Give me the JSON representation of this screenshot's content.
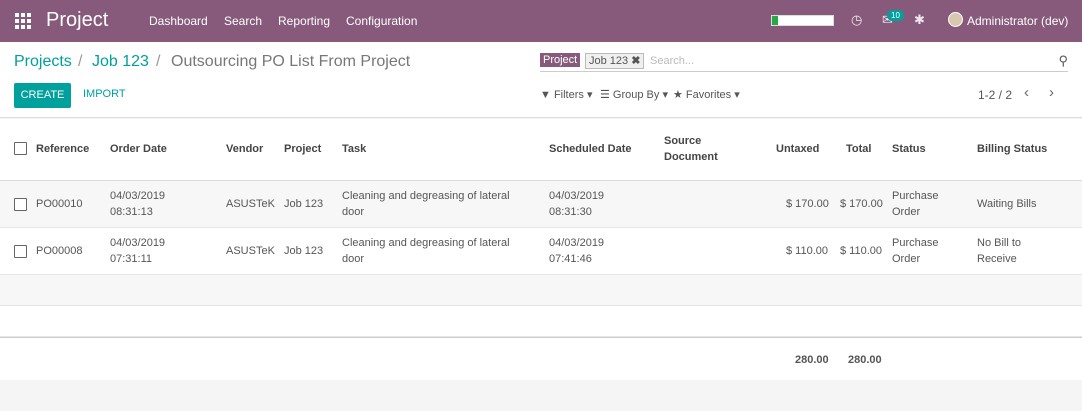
{
  "navbar": {
    "app_name": "Project",
    "menus": [
      "Dashboard",
      "Search",
      "Reporting",
      "Configuration"
    ],
    "progress_fraction": 0.1,
    "chat_badge": "10",
    "user": "Administrator (dev)",
    "accent": "#875a7b"
  },
  "breadcrumb": {
    "projects": "Projects",
    "job": "Job 123",
    "current": "Outsourcing PO List From Project",
    "sep": "/"
  },
  "actions": {
    "create": "CREATE",
    "import": "IMPORT"
  },
  "search": {
    "facet_label": "Project",
    "facet_value": "Job 123",
    "placeholder": "Search...",
    "filters": "Filters",
    "group_by": "Group By",
    "favorites": "Favorites"
  },
  "pager": {
    "text": "1-2 / 2"
  },
  "table": {
    "headers": {
      "reference": "Reference",
      "order_date": "Order Date",
      "vendor": "Vendor",
      "project": "Project",
      "task": "Task",
      "scheduled_date": "Scheduled Date",
      "source_doc_1": "Source",
      "source_doc_2": "Document",
      "untaxed": "Untaxed",
      "total": "Total",
      "status": "Status",
      "billing_status": "Billing Status"
    },
    "rows": [
      {
        "reference": "PO00010",
        "order_date_1": "04/03/2019",
        "order_date_2": "08:31:13",
        "vendor": "ASUSTeK",
        "project": "Job 123",
        "task_1": "Cleaning and degreasing of lateral",
        "task_2": "door",
        "scheduled_1": "04/03/2019",
        "scheduled_2": "08:31:30",
        "untaxed": "$ 170.00",
        "total": "$ 170.00",
        "status_1": "Purchase",
        "status_2": "Order",
        "billing_1": "Waiting Bills",
        "billing_2": ""
      },
      {
        "reference": "PO00008",
        "order_date_1": "04/03/2019",
        "order_date_2": "07:31:11",
        "vendor": "ASUSTeK",
        "project": "Job 123",
        "task_1": "Cleaning and degreasing of lateral",
        "task_2": "door",
        "scheduled_1": "04/03/2019",
        "scheduled_2": "07:41:46",
        "untaxed": "$ 110.00",
        "total": "$ 110.00",
        "status_1": "Purchase",
        "status_2": "Order",
        "billing_1": "No Bill to",
        "billing_2": "Receive"
      }
    ],
    "footer": {
      "untaxed": "280.00",
      "total": "280.00"
    }
  }
}
